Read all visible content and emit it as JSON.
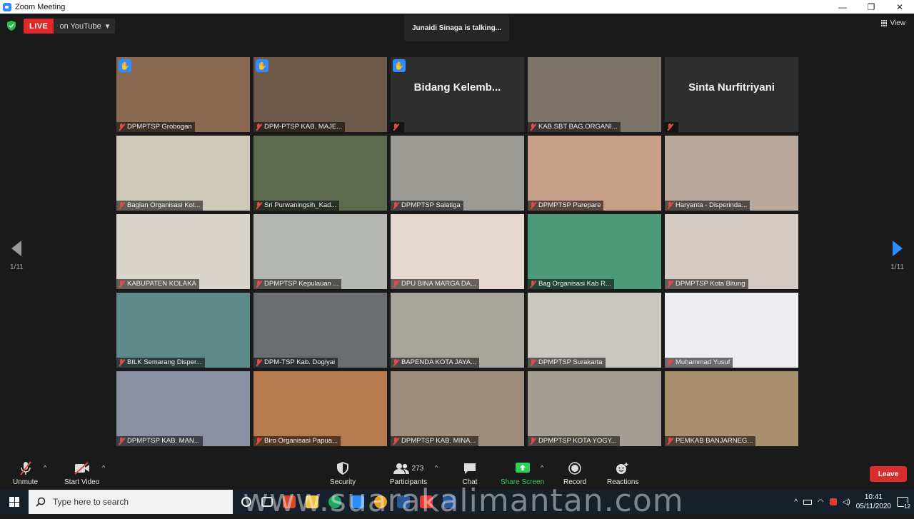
{
  "window": {
    "title": "Zoom Meeting",
    "minimize": "—",
    "maximize": "❐",
    "close": "✕"
  },
  "live": {
    "tag": "LIVE",
    "where": "on YouTube",
    "caret": "▾"
  },
  "speaker": {
    "text": "Junaidi Sinaga is talking..."
  },
  "view": {
    "label": "View"
  },
  "pagination": {
    "left": "1/11",
    "right": "1/11"
  },
  "tiles": [
    {
      "label": "DPMPTSP Grobogan",
      "hand": true,
      "bg": "#8a6a52"
    },
    {
      "label": "DPM-PTSP KAB. MAJE...",
      "hand": true,
      "bg": "#6e5a4a"
    },
    {
      "label": "",
      "name": "Bidang  Kelemb...",
      "hand": true,
      "bg": "#2e2e2e"
    },
    {
      "label": "KAB.SBT BAG.ORGANI...",
      "hand": false,
      "bg": "#7d7468"
    },
    {
      "label": "",
      "name": "Sinta Nurfitriyani",
      "hand": false,
      "bg": "#2e2e2e"
    },
    {
      "label": "Bagian Organisasi Kot...",
      "hand": false,
      "bg": "#cfc9b8"
    },
    {
      "label": "Sri Purwaningsih_Kad...",
      "hand": false,
      "bg": "#5e6a4e"
    },
    {
      "label": "DPMPTSP Salatiga",
      "hand": false,
      "bg": "#9b9a94"
    },
    {
      "label": "DPMPTSP Parepare",
      "hand": false,
      "bg": "#c8a08a"
    },
    {
      "label": "Haryanta - Disperinda...",
      "hand": false,
      "bg": "#b9a99c"
    },
    {
      "label": "KABUPATEN KOLAKA",
      "hand": false,
      "bg": "#d9d5cc"
    },
    {
      "label": "DPMPTSP Kepulauan ...",
      "hand": false,
      "bg": "#b5b7b3"
    },
    {
      "label": "DPU BINA MARGA DA...",
      "hand": false,
      "bg": "#e7d9d2"
    },
    {
      "label": "Bag Organisasi Kab R...",
      "hand": false,
      "bg": "#4d9a7a"
    },
    {
      "label": "DPMPTSP Kota Bitung",
      "hand": false,
      "bg": "#d4cbc4"
    },
    {
      "label": "BILK Semarang Disper...",
      "hand": false,
      "bg": "#5f8a8a"
    },
    {
      "label": "DPM-TSP Kab. Dogiyai",
      "hand": false,
      "bg": "#6a6e70"
    },
    {
      "label": "BAPENDA KOTA JAYA...",
      "hand": false,
      "bg": "#a7a59c"
    },
    {
      "label": "DPMPTSP Surakarta",
      "hand": false,
      "bg": "#c9c7c0"
    },
    {
      "label": "Muhammad Yusuf",
      "hand": false,
      "bg": "#eeeef2"
    },
    {
      "label": "DPMPTSP KAB. MAN...",
      "hand": false,
      "bg": "#8a90a0"
    },
    {
      "label": "Biro Organisasi Papua...",
      "hand": false,
      "bg": "#b67a4e"
    },
    {
      "label": "DPMPTSP KAB. MINA...",
      "hand": false,
      "bg": "#9b8c7c"
    },
    {
      "label": "DPMPTSP KOTA YOGY...",
      "hand": false,
      "bg": "#a49e92"
    },
    {
      "label": "PEMKAB BANJARNEG...",
      "hand": false,
      "bg": "#a78e6c"
    }
  ],
  "toolbar": {
    "unmute": "Unmute",
    "start_video": "Start Video",
    "security": "Security",
    "participants": "Participants",
    "participants_count": "273",
    "chat": "Chat",
    "share_screen": "Share Screen",
    "record": "Record",
    "reactions": "Reactions",
    "leave": "Leave",
    "caret": "^"
  },
  "taskbar": {
    "search_placeholder": "Type here to search",
    "time": "10:41",
    "date": "05/11/2020",
    "notifications": "12"
  },
  "watermark": "www.suarakalimantan.com",
  "colors": {
    "accent": "#2d8cff",
    "live_red": "#e02828",
    "leave_red": "#d92d2d",
    "share_green": "#2fd05a"
  }
}
